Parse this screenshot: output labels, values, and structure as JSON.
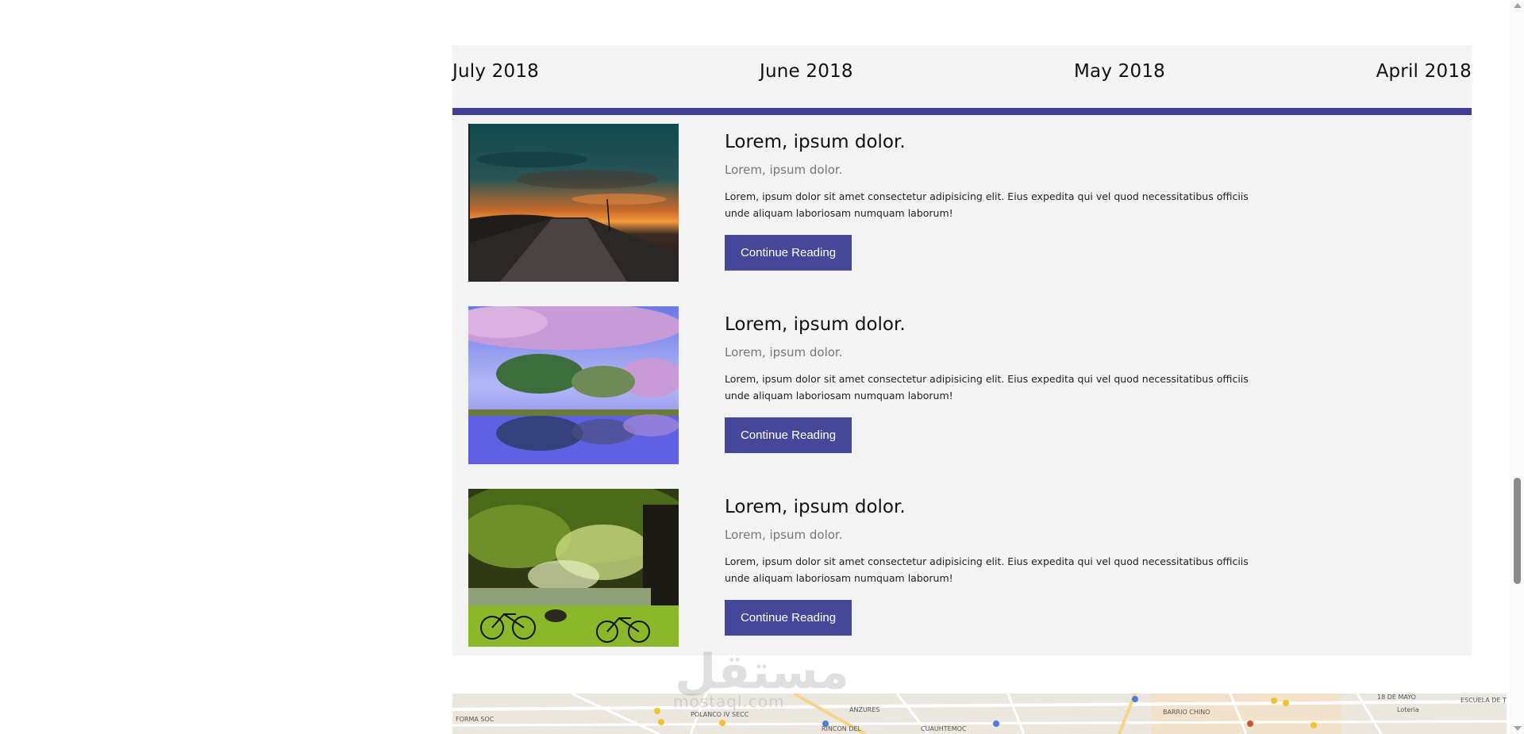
{
  "timeline": {
    "months": [
      "July 2018",
      "June 2018",
      "May 2018",
      "April 2018"
    ],
    "accent_color": "#3f3f95"
  },
  "posts": [
    {
      "title": "Lorem, ipsum dolor.",
      "subtitle": "Lorem, ipsum dolor.",
      "text": "Lorem, ipsum dolor sit amet consectetur adipisicing elit. Eius expedita qui vel quod necessitatibus officiis unde aliquam laboriosam numquam laborum!",
      "button_label": "Continue Reading"
    },
    {
      "title": "Lorem, ipsum dolor.",
      "subtitle": "Lorem, ipsum dolor.",
      "text": "Lorem, ipsum dolor sit amet consectetur adipisicing elit. Eius expedita qui vel quod necessitatibus officiis unde aliquam laboriosam numquam laborum!",
      "button_label": "Continue Reading"
    },
    {
      "title": "Lorem, ipsum dolor.",
      "subtitle": "Lorem, ipsum dolor.",
      "text": "Lorem, ipsum dolor sit amet consectetur adipisicing elit. Eius expedita qui vel quod necessitatibus officiis unde aliquam laboriosam numquam laborum!",
      "button_label": "Continue Reading"
    }
  ],
  "button_color": "#45479a",
  "watermark": {
    "arabic": "مستقل",
    "latin": "mostaql.com"
  },
  "map": {
    "labels": [
      "FORMA SOC",
      "POLANCO IV SECC",
      "ANZURES",
      "RINCON DEL",
      "CUAUHTEMOC",
      "BARRIO CHINO",
      "Loteria",
      "18 DE MAYO",
      "ESCUELA DE TIRO"
    ]
  }
}
